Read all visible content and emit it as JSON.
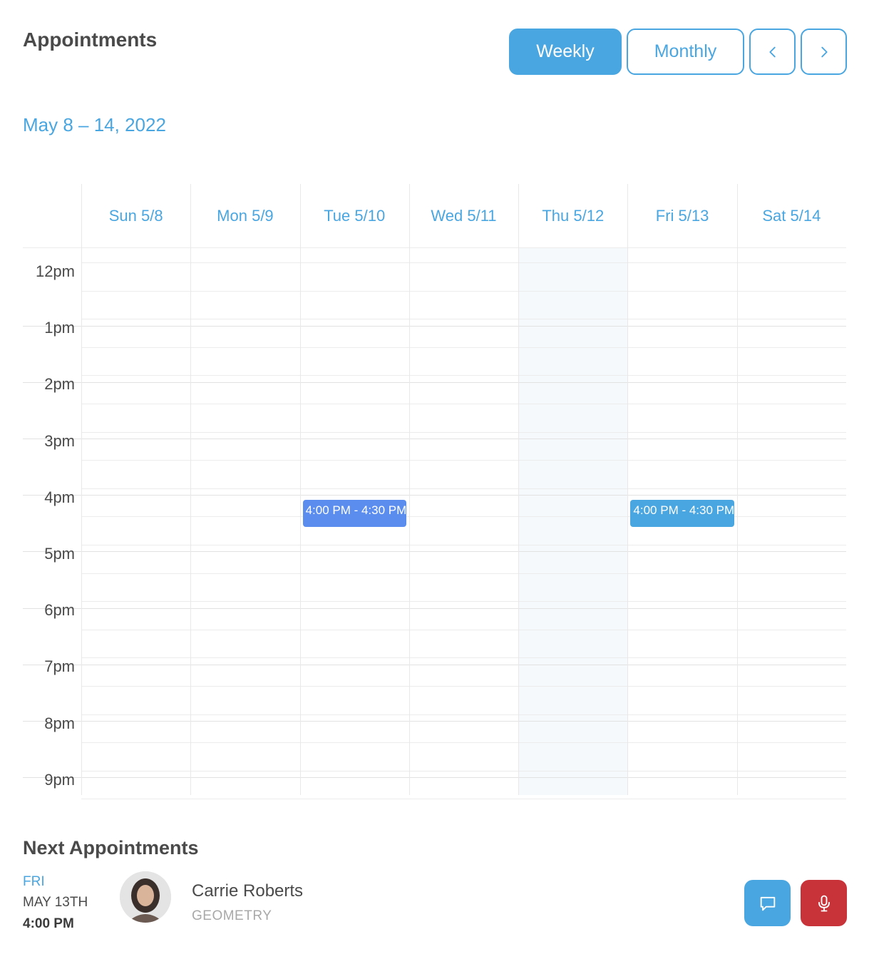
{
  "header": {
    "title": "Appointments",
    "weekly_label": "Weekly",
    "monthly_label": "Monthly",
    "prev_icon": "chevron-left-icon",
    "next_icon": "chevron-right-icon"
  },
  "date_range": "May 8 – 14, 2022",
  "calendar": {
    "days": [
      "Sun 5/8",
      "Mon 5/9",
      "Tue 5/10",
      "Wed 5/11",
      "Thu 5/12",
      "Fri 5/13",
      "Sat 5/14"
    ],
    "today": "Thu 5/12",
    "hours": [
      "12pm",
      "1pm",
      "2pm",
      "3pm",
      "4pm",
      "5pm",
      "6pm",
      "7pm",
      "8pm",
      "9pm"
    ],
    "events": [
      {
        "day": "Tue 5/10",
        "label": "4:00 PM - 4:30 PM",
        "start": "4pm",
        "color": "#5b8def"
      },
      {
        "day": "Fri 5/13",
        "label": "4:00 PM - 4:30 PM",
        "start": "4pm",
        "color": "#4aa6e0"
      }
    ]
  },
  "next_appointments": {
    "title": "Next Appointments",
    "items": [
      {
        "day": "FRI",
        "date": "MAY 13TH",
        "time": "4:00 PM",
        "name": "Carrie Roberts",
        "subject": "GEOMETRY",
        "chat_icon": "chat-icon",
        "mic_icon": "microphone-icon"
      }
    ]
  },
  "colors": {
    "accent": "#4aa6e0",
    "event_tue": "#5b8def",
    "mic_button": "#c8333a",
    "today_bg": "#f6f9fc"
  }
}
